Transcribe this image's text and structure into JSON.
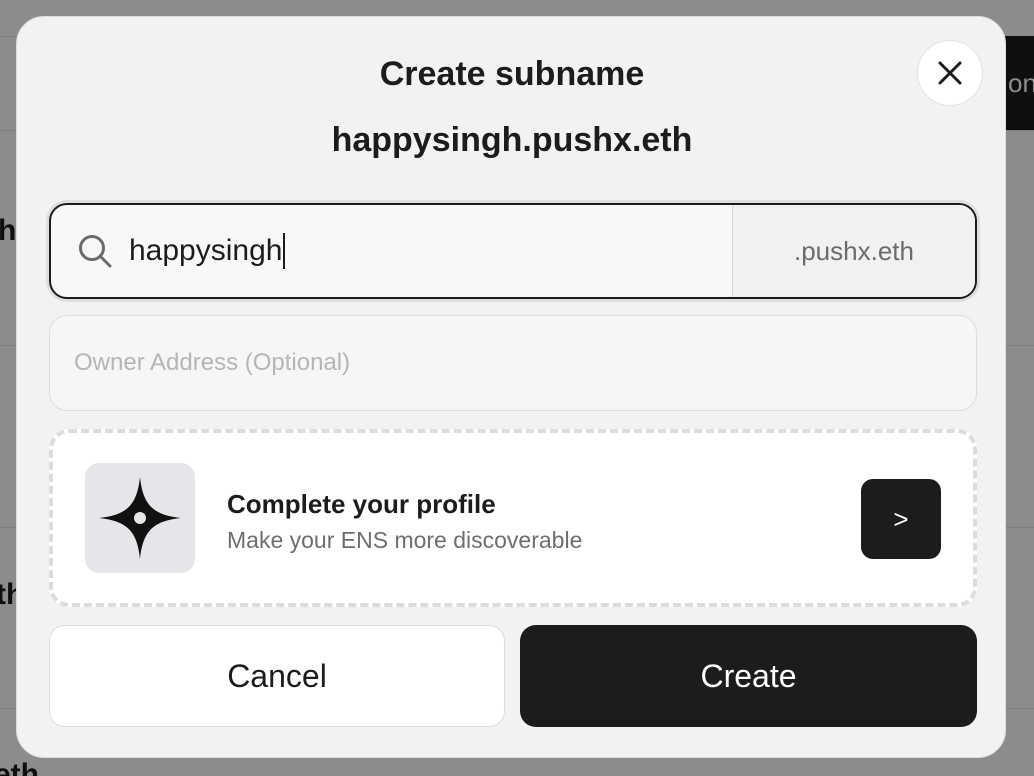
{
  "background": {
    "header_button_fragment": "on",
    "row_fragments": [
      "h",
      "th",
      "eth"
    ]
  },
  "modal": {
    "title": "Create subname",
    "subtitle": "happysingh.pushx.eth",
    "close_icon": "close-icon",
    "search": {
      "icon": "search-icon",
      "value": "happysingh",
      "suffix": ".pushx.eth"
    },
    "owner": {
      "value": "",
      "placeholder": "Owner Address (Optional)"
    },
    "profile_card": {
      "icon": "sparkle-icon",
      "title": "Complete your profile",
      "description": "Make your ENS more discoverable",
      "next_label": ">"
    },
    "buttons": {
      "cancel": "Cancel",
      "create": "Create"
    }
  },
  "colors": {
    "primary": "#1c1c1c",
    "modal_bg": "#f2f2f2",
    "muted_text": "#6e6e6e"
  }
}
